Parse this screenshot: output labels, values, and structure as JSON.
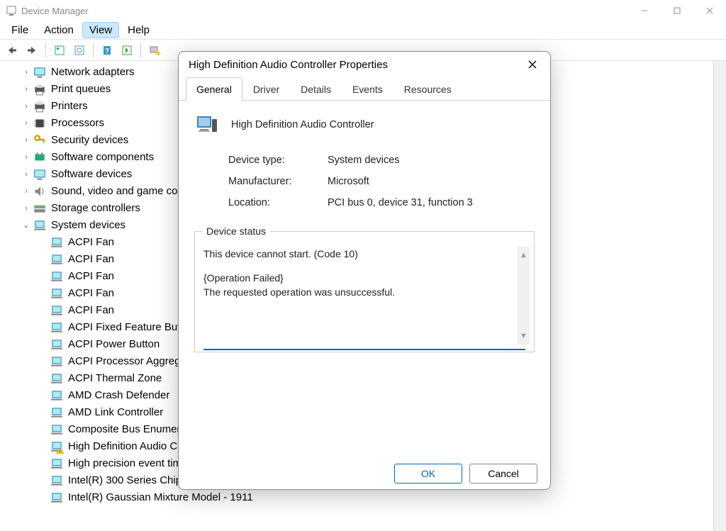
{
  "window": {
    "title": "Device Manager"
  },
  "menu": {
    "file": "File",
    "action": "Action",
    "view": "View",
    "help": "Help"
  },
  "tree": {
    "top": [
      {
        "label": "Network adapters"
      },
      {
        "label": "Print queues"
      },
      {
        "label": "Printers"
      },
      {
        "label": "Processors"
      },
      {
        "label": "Security devices"
      },
      {
        "label": "Software components"
      },
      {
        "label": "Software devices"
      },
      {
        "label": "Sound, video and game controllers"
      },
      {
        "label": "Storage controllers"
      }
    ],
    "system_devices_label": "System devices",
    "children": [
      "ACPI Fan",
      "ACPI Fan",
      "ACPI Fan",
      "ACPI Fan",
      "ACPI Fan",
      "ACPI Fixed Feature Button",
      "ACPI Power Button",
      "ACPI Processor Aggregator",
      "ACPI Thermal Zone",
      "AMD Crash Defender",
      "AMD Link Controller",
      "Composite Bus Enumerator",
      "High Definition Audio Controller",
      "High precision event timer",
      "Intel(R) 300 Series Chipset Family LPC Controller (B360) - A308",
      "Intel(R) Gaussian Mixture Model - 1911"
    ],
    "warn_index": 12
  },
  "dialog": {
    "title": "High Definition Audio Controller Properties",
    "tabs": {
      "general": "General",
      "driver": "Driver",
      "details": "Details",
      "events": "Events",
      "resources": "Resources"
    },
    "device_name": "High Definition Audio Controller",
    "labels": {
      "device_type": "Device type:",
      "manufacturer": "Manufacturer:",
      "location": "Location:",
      "device_status": "Device status"
    },
    "values": {
      "device_type": "System devices",
      "manufacturer": "Microsoft",
      "location": "PCI bus 0, device 31, function 3"
    },
    "status": {
      "line1": "This device cannot start. (Code 10)",
      "line2": "{Operation Failed}",
      "line3": "The requested operation was unsuccessful."
    },
    "buttons": {
      "ok": "OK",
      "cancel": "Cancel"
    }
  }
}
